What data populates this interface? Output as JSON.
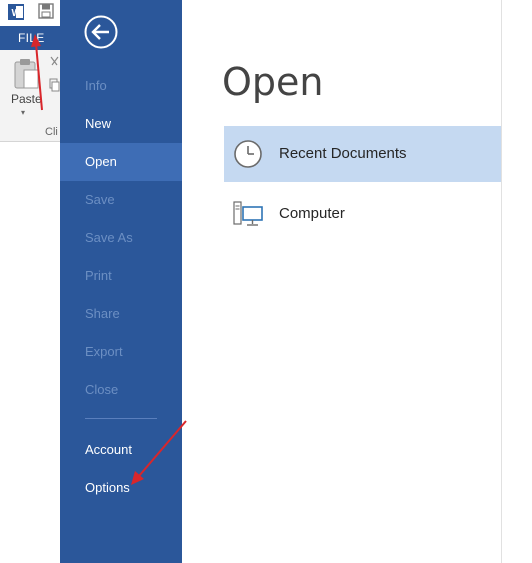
{
  "ribbon": {
    "file_tab": "FILE",
    "paste_label": "Paste",
    "paste_dropdown": "▾",
    "clipboard_group_partial": "Cli"
  },
  "backstage": {
    "items": [
      {
        "label": "Info",
        "state": "disabled"
      },
      {
        "label": "New",
        "state": "enabled"
      },
      {
        "label": "Open",
        "state": "selected"
      },
      {
        "label": "Save",
        "state": "disabled"
      },
      {
        "label": "Save As",
        "state": "disabled"
      },
      {
        "label": "Print",
        "state": "disabled"
      },
      {
        "label": "Share",
        "state": "disabled"
      },
      {
        "label": "Export",
        "state": "disabled"
      },
      {
        "label": "Close",
        "state": "disabled"
      },
      {
        "label": "Account",
        "state": "enabled"
      },
      {
        "label": "Options",
        "state": "enabled"
      }
    ]
  },
  "main": {
    "title": "Open",
    "locations": [
      {
        "label": "Recent Documents",
        "icon": "clock-icon",
        "selected": true
      },
      {
        "label": "Computer",
        "icon": "computer-icon",
        "selected": false
      }
    ]
  },
  "colors": {
    "backstage_blue": "#2b579a",
    "selected_nav": "#3e6db5",
    "disabled_text": "#6c8fc3",
    "selected_location": "#c5d9f1",
    "annotation_red": "#d9262b"
  }
}
